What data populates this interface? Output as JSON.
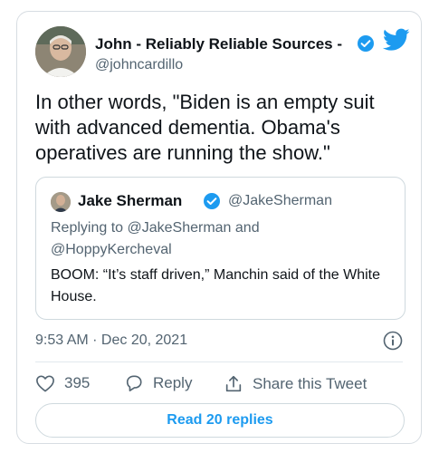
{
  "tweet": {
    "author_name": "John - Reliably Reliable Sources -",
    "author_handle": "@johncardillo",
    "text": "In other words, \"Biden is an empty suit with advanced dementia. Obama's operatives are running the show.\""
  },
  "quoted": {
    "author_name": "Jake Sherman",
    "author_handle": "@JakeSherman",
    "replying_to": "Replying to @JakeSherman and @HoppyKercheval",
    "text": "BOOM: “It’s staff driven,” Manchin said of the White House."
  },
  "meta": {
    "timestamp": "9:53 AM · Dec 20, 2021"
  },
  "actions": {
    "like_count": "395",
    "reply_label": "Reply",
    "share_label": "Share this Tweet"
  },
  "read_replies_label": "Read 20 replies",
  "colors": {
    "accent": "#1d9bf0",
    "muted": "#536471",
    "border": "#cfd9de"
  },
  "icons": [
    "verified-badge-icon",
    "twitter-bird-icon",
    "info-icon",
    "heart-icon",
    "reply-bubble-icon",
    "share-icon"
  ]
}
